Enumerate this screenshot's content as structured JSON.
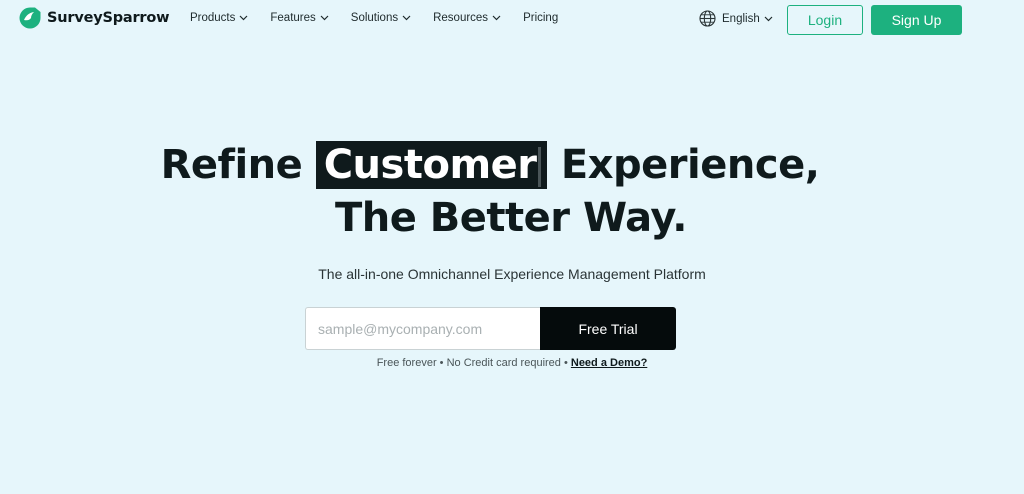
{
  "brand": {
    "name": "SurveySparrow",
    "accent": "#1db17f",
    "dark": "#0f1a1c",
    "background": "#e6f6fb"
  },
  "nav": {
    "items": [
      {
        "label": "Products",
        "has_dropdown": true
      },
      {
        "label": "Features",
        "has_dropdown": true
      },
      {
        "label": "Solutions",
        "has_dropdown": true
      },
      {
        "label": "Resources",
        "has_dropdown": true
      },
      {
        "label": "Pricing",
        "has_dropdown": false
      }
    ],
    "language": {
      "label": "English",
      "icon": "globe-icon"
    },
    "login_label": "Login",
    "signup_label": "Sign Up"
  },
  "hero": {
    "line1_before": "Refine",
    "line1_highlight": "Customer",
    "line1_after": "Experience,",
    "line2": "The Better Way.",
    "subtitle": "The all-in-one Omnichannel Experience Management Platform"
  },
  "form": {
    "email_placeholder": "sample@mycompany.com",
    "email_value": "",
    "cta_label": "Free Trial"
  },
  "note": {
    "text": "Free forever • No Credit card required •",
    "demo_link": "Need a Demo?"
  }
}
